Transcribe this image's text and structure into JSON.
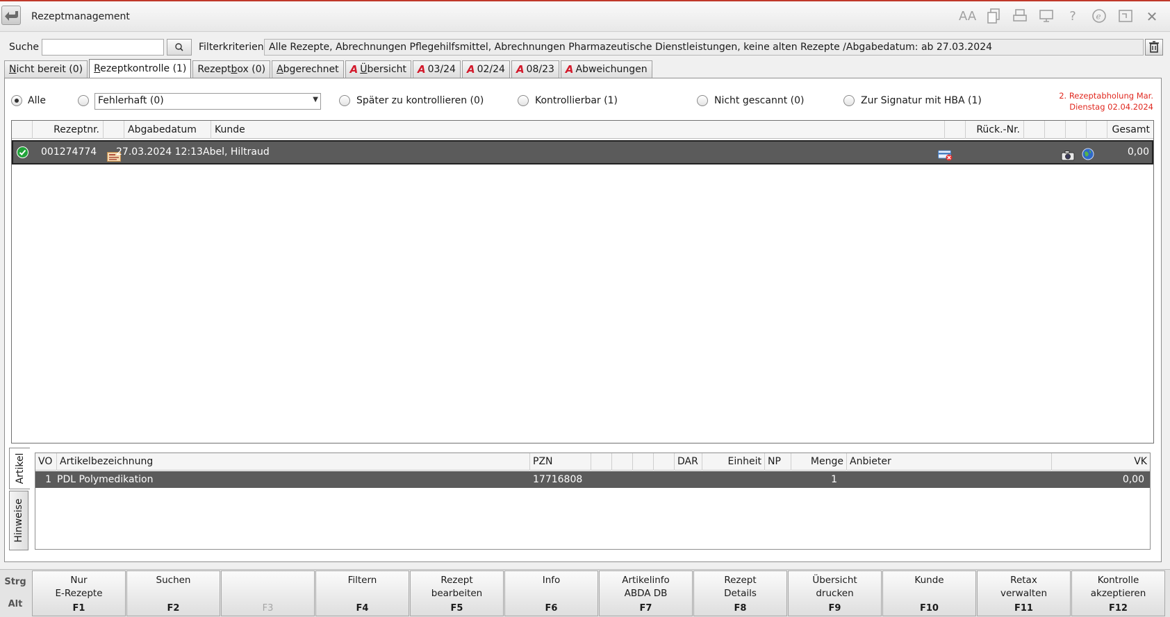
{
  "window": {
    "title": "Rezeptmanagement"
  },
  "search": {
    "label": "Suche",
    "value": "",
    "placeholder": ""
  },
  "filter": {
    "label": "Filterkriterien",
    "value": "Alle Rezepte, Abrechnungen Pflegehilfsmittel, Abrechnungen Pharmazeutische Dienstleistungen, keine alten Rezepte /Abgabedatum: ab 27.03.2024"
  },
  "tabs": [
    {
      "key": "N",
      "rest": "icht bereit (0)",
      "active": false
    },
    {
      "key": "R",
      "rest": "ezeptkontrolle (1)",
      "active": true
    },
    {
      "pre": "Rezept",
      "key": "b",
      "rest": "ox (0)",
      "active": false
    },
    {
      "key": "A",
      "rest": "bgerechnet",
      "active": false
    },
    {
      "key": "Ü",
      "rest": "bersicht",
      "active": false,
      "abda": true
    },
    {
      "rest": "03/24",
      "active": false,
      "abda": true
    },
    {
      "rest": "02/24",
      "active": false,
      "abda": true
    },
    {
      "rest": "08/23",
      "active": false,
      "abda": true
    },
    {
      "rest": "Abweichungen",
      "active": false,
      "abda": true
    }
  ],
  "radios": {
    "alle": "Alle",
    "fehlerhaft": "Fehlerhaft (0)",
    "spaeter": "Später zu kontrollieren (0)",
    "kontrollierbar": "Kontrollierbar (1)",
    "nicht_gescannt": "Nicht gescannt (0)",
    "signatur": "Zur Signatur mit HBA (1)",
    "selected": "alle"
  },
  "pickup": {
    "line1": "2. Rezeptabholung  Mar.",
    "line2": "Dienstag 02.04.2024"
  },
  "grid": {
    "headers": {
      "rezeptnr": "Rezeptnr.",
      "abgabedatum": "Abgabedatum",
      "kunde": "Kunde",
      "rueck": "Rück.-Nr.",
      "gesamt": "Gesamt"
    },
    "rows": [
      {
        "rezeptnr": "001274774",
        "abgabedatum": "27.03.2024 12:13",
        "kunde": "Abel, Hiltraud",
        "rueck": "",
        "gesamt": "0,00"
      }
    ]
  },
  "sidetabs": {
    "artikel": "Artikel",
    "hinweise": "Hinweise"
  },
  "articles": {
    "headers": {
      "vo": "VO",
      "bezeichnung": "Artikelbezeichnung",
      "pzn": "PZN",
      "dar": "DAR",
      "einheit": "Einheit",
      "np": "NP",
      "menge": "Menge",
      "anbieter": "Anbieter",
      "vk": "VK"
    },
    "rows": [
      {
        "vo": "1",
        "bezeichnung": "PDL Polymedikation",
        "pzn": "17716808",
        "menge": "1",
        "vk": "0,00"
      }
    ]
  },
  "modifiers": {
    "strg": "Strg",
    "alt": "Alt"
  },
  "fkeys": [
    {
      "label": "Nur\nE-Rezepte",
      "key": "F1"
    },
    {
      "label": "Suchen",
      "key": "F2"
    },
    {
      "label": "",
      "key": "F3",
      "disabled": true
    },
    {
      "label": "Filtern",
      "key": "F4"
    },
    {
      "label": "Rezept\nbearbeiten",
      "key": "F5"
    },
    {
      "label": "Info",
      "key": "F6"
    },
    {
      "label": "Artikelinfo\nABDA DB",
      "key": "F7"
    },
    {
      "label": "Rezept\nDetails",
      "key": "F8"
    },
    {
      "label": "Übersicht\ndrucken",
      "key": "F9"
    },
    {
      "label": "Kunde",
      "key": "F10"
    },
    {
      "label": "Retax\nverwalten",
      "key": "F11"
    },
    {
      "label": "Kontrolle\nakzeptieren",
      "key": "F12"
    }
  ]
}
